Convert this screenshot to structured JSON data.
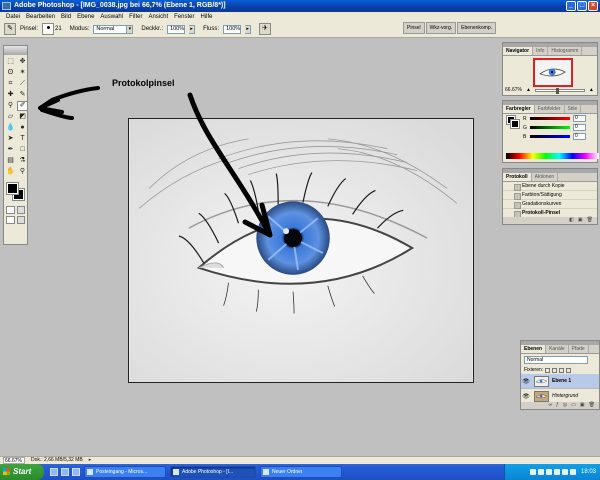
{
  "window": {
    "title": "Adobe Photoshop - [IMG_0038.jpg bei 66,7% (Ebene 1, RGB/8*)]"
  },
  "menubar": [
    "Datei",
    "Bearbeiten",
    "Bild",
    "Ebene",
    "Auswahl",
    "Filter",
    "Ansicht",
    "Fenster",
    "Hilfe"
  ],
  "options": {
    "brush_label": "Pinsel:",
    "brush_size": "21",
    "mode_label": "Modus:",
    "mode_value": "Normal",
    "opacity_label": "Deckkr.:",
    "opacity_value": "100%",
    "flow_label": "Fluss:",
    "flow_value": "100%",
    "well_tabs": [
      "Pinsel",
      "Wkz-vorg.",
      "Ebenenkomp."
    ]
  },
  "annotation": {
    "text": "Protokolpinsel"
  },
  "navigator": {
    "tabs": [
      "Navigator",
      "Info",
      "Histogramm"
    ],
    "zoom": "66.67%"
  },
  "color": {
    "tabs": [
      "Farbregler",
      "Farbfelder",
      "Stile"
    ],
    "rows": [
      {
        "label": "R",
        "value": "0",
        "gradient": "linear-gradient(90deg,#000,#f00)"
      },
      {
        "label": "G",
        "value": "0",
        "gradient": "linear-gradient(90deg,#000,#0f0)"
      },
      {
        "label": "B",
        "value": "0",
        "gradient": "linear-gradient(90deg,#000,#00f)"
      }
    ]
  },
  "history": {
    "tabs": [
      "Protokoll",
      "Aktionen"
    ],
    "items": [
      "Ebene durch Kopie",
      "Farbton/Sättigung",
      "Gradationskurven",
      "Protokoll-Pinsel"
    ],
    "active_index": 3
  },
  "layers": {
    "tabs": [
      "Ebenen",
      "Kanäle",
      "Pfade"
    ],
    "blend_mode": "Normal",
    "lock_label": "Fixieren:",
    "items": [
      {
        "name": "Ebene 1",
        "active": true
      },
      {
        "name": "Hintergrund",
        "active": false
      }
    ]
  },
  "status": {
    "zoom": "66.67%",
    "doc": "Dok.: 2,66 MB/5,32 MB"
  },
  "taskbar": {
    "start": "Start",
    "tasks": [
      {
        "label": "Posteingang - Micros...",
        "active": false
      },
      {
        "label": "Adobe Photoshop - [I...",
        "active": true
      },
      {
        "label": "Neuer Ordner",
        "active": false
      }
    ],
    "clock": "18:03"
  },
  "colors": {
    "iris_blue": "#3a78d8",
    "selection_red": "#e02020",
    "taskbar_blue": "#245dd8"
  }
}
